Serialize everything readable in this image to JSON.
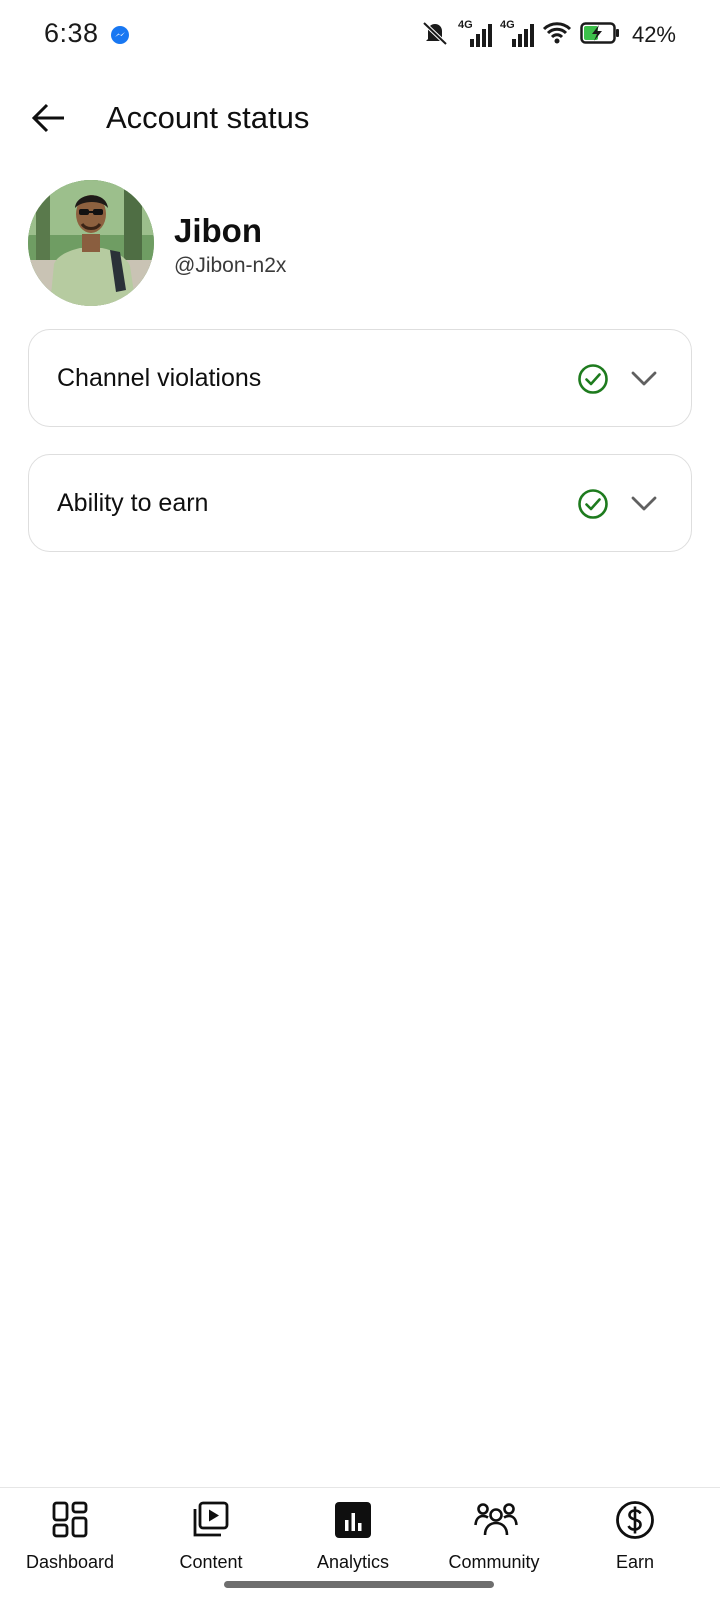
{
  "status_bar": {
    "time": "6:38",
    "battery_percent": "42%",
    "network_1": "4G",
    "network_2": "4G",
    "icons": [
      "messenger-icon",
      "mute-icon",
      "signal-icon",
      "signal-icon",
      "wifi-icon",
      "battery-charging-icon"
    ]
  },
  "header": {
    "title": "Account status",
    "back_icon": "arrow-left-icon"
  },
  "profile": {
    "name": "Jibon",
    "handle": "@Jibon-n2x"
  },
  "cards": [
    {
      "label": "Channel violations",
      "status_icon": "check-circle-icon",
      "chevron_icon": "chevron-down-icon"
    },
    {
      "label": "Ability to earn",
      "status_icon": "check-circle-icon",
      "chevron_icon": "chevron-down-icon"
    }
  ],
  "bottom_nav": {
    "items": [
      {
        "label": "Dashboard",
        "icon": "dashboard-icon"
      },
      {
        "label": "Content",
        "icon": "content-icon"
      },
      {
        "label": "Analytics",
        "icon": "analytics-icon",
        "selected": true
      },
      {
        "label": "Community",
        "icon": "community-icon"
      },
      {
        "label": "Earn",
        "icon": "earn-icon"
      }
    ]
  },
  "colors": {
    "check_green": "#1e7b1e",
    "chevron_grey": "#606060",
    "card_border": "#dedede",
    "text_primary": "#0f0f0f"
  }
}
